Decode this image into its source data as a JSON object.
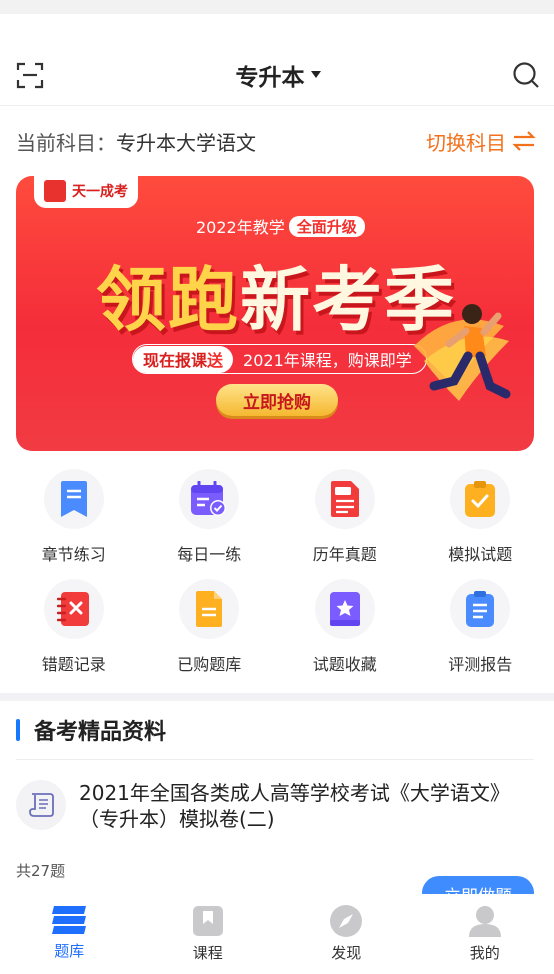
{
  "header": {
    "title": "专升本",
    "scan_icon": "scan-icon",
    "search_icon": "search-icon"
  },
  "subject": {
    "label": "当前科目：",
    "value": "专升本大学语文",
    "switch_label": "切换科目"
  },
  "banner": {
    "brand": "天一成考",
    "tagline": "2022年教学",
    "tagline_pill": "全面升级",
    "headline_a": "领跑",
    "headline_b": "新考季",
    "promo_prefix": "现在报课",
    "promo_highlight": "送",
    "promo_suffix": "2021年课程，购课即学",
    "cta": "立即抢购"
  },
  "features": [
    {
      "label": "章节练习",
      "icon": "bookmark-icon",
      "color": "#4a8cff"
    },
    {
      "label": "每日一练",
      "icon": "calendar-icon",
      "color": "#7a5cff"
    },
    {
      "label": "历年真题",
      "icon": "exam-paper-icon",
      "color": "#f23b3b"
    },
    {
      "label": "模拟试题",
      "icon": "clipboard-check-icon",
      "color": "#ffb020"
    },
    {
      "label": "错题记录",
      "icon": "wrong-notebook-icon",
      "color": "#f23b3b"
    },
    {
      "label": "已购题库",
      "icon": "document-icon",
      "color": "#ffb020"
    },
    {
      "label": "试题收藏",
      "icon": "star-folder-icon",
      "color": "#7a5cff"
    },
    {
      "label": "评测报告",
      "icon": "report-icon",
      "color": "#4a8cff"
    }
  ],
  "section": {
    "title": "备考精品资料"
  },
  "material": {
    "title": "2021年全国各类成人高等学校考试《大学语文》（专升本）模拟卷(二)",
    "count": "共27题",
    "button": "立即做题"
  },
  "tabbar": [
    {
      "label": "题库",
      "icon": "question-bank-icon",
      "active": true
    },
    {
      "label": "课程",
      "icon": "course-bookmark-icon",
      "active": false
    },
    {
      "label": "发现",
      "icon": "compass-icon",
      "active": false
    },
    {
      "label": "我的",
      "icon": "user-icon",
      "active": false
    }
  ],
  "colors": {
    "accent_orange": "#f2711c",
    "accent_blue": "#1677ff",
    "banner_red": "#f42d3a"
  }
}
